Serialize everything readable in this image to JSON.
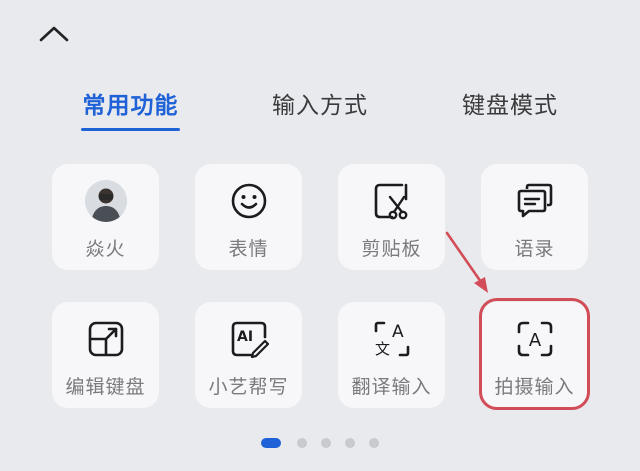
{
  "tabs": [
    {
      "label": "常用功能",
      "active": true
    },
    {
      "label": "输入方式",
      "active": false
    },
    {
      "label": "键盘模式",
      "active": false
    }
  ],
  "tiles": [
    {
      "label": "焱火",
      "icon": "user-avatar"
    },
    {
      "label": "表情",
      "icon": "smiley-icon"
    },
    {
      "label": "剪贴板",
      "icon": "clipboard-scissors-icon"
    },
    {
      "label": "语录",
      "icon": "chat-bubbles-icon"
    },
    {
      "label": "编辑键盘",
      "icon": "edit-keyboard-icon"
    },
    {
      "label": "小艺帮写",
      "icon": "ai-write-icon"
    },
    {
      "label": "翻译输入",
      "icon": "translate-icon"
    },
    {
      "label": "拍摄输入",
      "icon": "camera-text-icon"
    }
  ],
  "icon_ai_text": "AI",
  "icon_translate_text": "A",
  "icon_translate_zh": "文",
  "icon_camera_text": "A",
  "pagination": {
    "total": 5,
    "active_index": 0
  },
  "colors": {
    "accent": "#1f61d6",
    "highlight": "#d24d57",
    "background": "#e9eaee"
  }
}
